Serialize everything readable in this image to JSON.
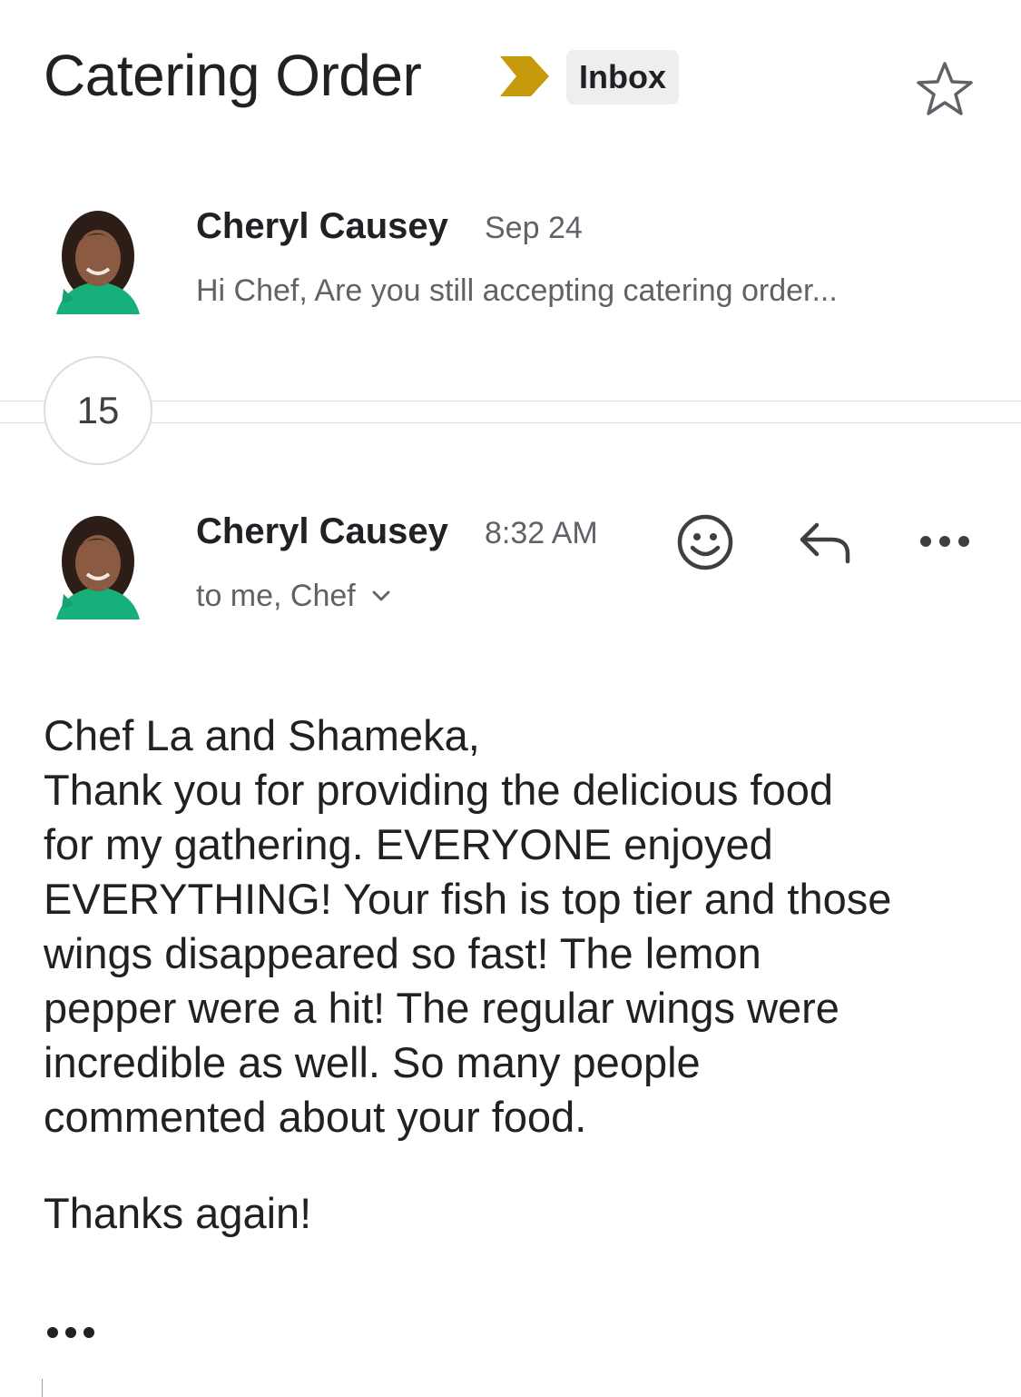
{
  "thread": {
    "subject": "Catering Order",
    "label": "Inbox",
    "importance_color": "#C69A0A",
    "star_icon": "star-outline-icon"
  },
  "first_message": {
    "sender": "Cheryl Causey",
    "date": "Sep 24",
    "snippet": "Hi Chef, Are you still accepting catering order..."
  },
  "collapsed": {
    "count": "15"
  },
  "latest_message": {
    "sender": "Cheryl Causey",
    "time": "8:32 AM",
    "recipients": "to me, Chef",
    "actions": [
      "emoji-reaction-icon",
      "reply-icon",
      "more-options-icon"
    ],
    "body_lines": [
      "Chef La and Shameka,",
      "Thank you for providing the delicious food",
      "for my gathering. EVERYONE enjoyed",
      "EVERYTHING! Your fish is top tier and those",
      "wings disappeared so fast! The lemon",
      "pepper were a hit! The regular wings were",
      "incredible as well. So many people",
      "commented about your food."
    ],
    "signoff": "Thanks again!"
  },
  "colors": {
    "avatar_top": "#3A2A22",
    "avatar_shirt": "#18B07A",
    "secondary_text": "#5f6368"
  }
}
